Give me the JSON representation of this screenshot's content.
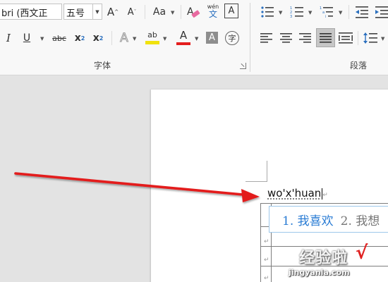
{
  "ribbon": {
    "font_group_label": "字体",
    "paragraph_group_label": "段落",
    "font_name": "bri (西文正",
    "font_size": "五号",
    "grow_font": "A",
    "shrink_font": "A",
    "change_case": "Aa",
    "phonetic_top": "wén",
    "phonetic_bottom": "文",
    "char_border": "A",
    "bold": "I",
    "underline": "U",
    "strikethrough": "abc",
    "subscript": "x",
    "subscript_sub": "2",
    "superscript": "x",
    "superscript_sup": "2",
    "text_effects": "A",
    "highlight_label": "ab",
    "font_color": "A",
    "char_shading": "A",
    "enclose_char": "字",
    "highlight_color": "#f0e20e",
    "font_color_bar": "#e41e1e"
  },
  "document": {
    "typed_text": "wo'x'huan",
    "paragraph_mark": "↵"
  },
  "ime": {
    "candidates": [
      "1. 我喜欢",
      "2. 我想"
    ]
  },
  "watermark": {
    "text": "经验啦",
    "check": "√",
    "url": "jingyanla.com"
  },
  "colors": {
    "arrow": "#e31b1b",
    "ime_selected": "#2a7cd4"
  }
}
